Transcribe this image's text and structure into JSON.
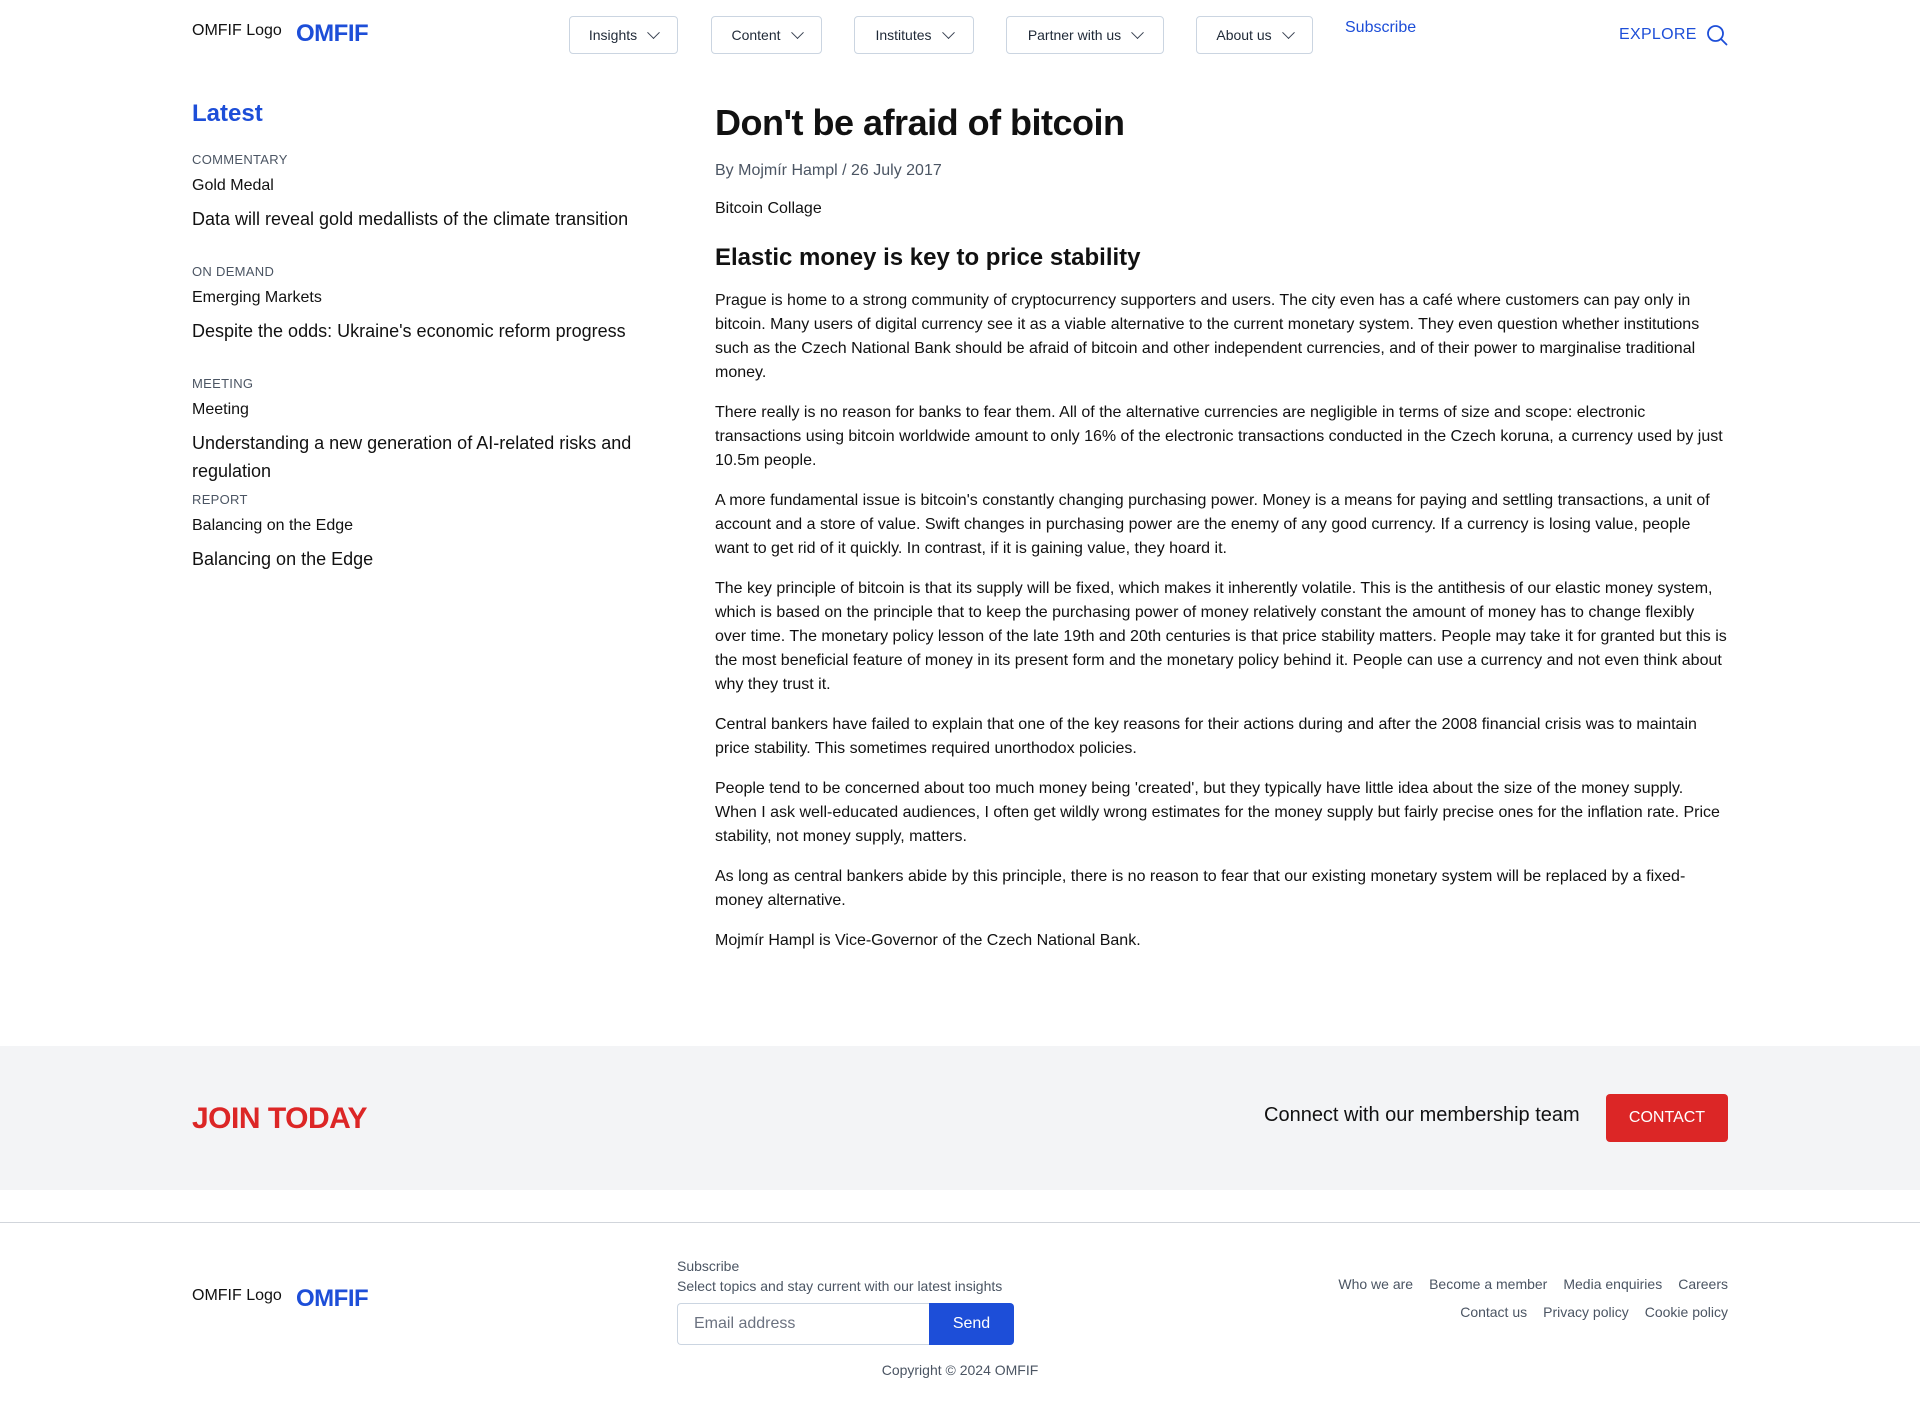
{
  "header": {
    "logo_alt": "OMFIF Logo",
    "logo_text": "OMFIF",
    "nav": [
      {
        "label": "Insights"
      },
      {
        "label": "Content"
      },
      {
        "label": "Institutes"
      },
      {
        "label": "Partner with us"
      },
      {
        "label": "About us"
      }
    ],
    "subscribe": "Subscribe",
    "explore": "EXPLORE",
    "search_icon": "search-icon"
  },
  "sidebar": {
    "title": "Latest",
    "items": [
      {
        "category": "COMMENTARY",
        "subtitle": "Gold Medal",
        "headline": "Data will reveal gold medallists of the climate transition"
      },
      {
        "category": "ON DEMAND",
        "subtitle": "Emerging Markets",
        "headline": "Despite the odds: Ukraine's economic reform progress"
      },
      {
        "category": "MEETING",
        "subtitle": "Meeting",
        "headline": "Understanding a new generation of AI-related risks and regulation"
      },
      {
        "category": "REPORT",
        "subtitle": "Balancing on the Edge",
        "headline": "Balancing on the Edge"
      }
    ]
  },
  "article": {
    "title": "Don't be afraid of bitcoin",
    "byline": "By Mojmír Hampl / 26 July 2017",
    "image_alt": "Bitcoin Collage",
    "subheading": "Elastic money is key to price stability",
    "paragraphs": [
      "Prague is home to a strong community of cryptocurrency supporters and users. The city even has a café where customers can pay only in bitcoin. Many users of digital currency see it as a viable alternative to the current monetary system. They even question whether institutions such as the Czech National Bank should be afraid of bitcoin and other independent currencies, and of their power to marginalise traditional money.",
      "There really is no reason for banks to fear them. All of the alternative currencies are negligible in terms of size and scope: electronic transactions using bitcoin worldwide amount to only 16% of the electronic transactions conducted in the Czech koruna, a currency used by just 10.5m people.",
      "A more fundamental issue is bitcoin's constantly changing purchasing power. Money is a means for paying and settling transactions, a unit of account and a store of value. Swift changes in purchasing power are the enemy of any good currency. If a currency is losing value, people want to get rid of it quickly. In contrast, if it is gaining value, they hoard it.",
      "The key principle of bitcoin is that its supply will be fixed, which makes it inherently volatile. This is the antithesis of our elastic money system, which is based on the principle that to keep the purchasing power of money relatively constant the amount of money has to change flexibly over time. The monetary policy lesson of the late 19th and 20th centuries is that price stability matters. People may take it for granted but this is the most beneficial feature of money in its present form and the monetary policy behind it. People can use a currency and not even think about why they trust it.",
      "Central bankers have failed to explain that one of the key reasons for their actions during and after the 2008 financial crisis was to maintain price stability. This sometimes required unorthodox policies.",
      "People tend to be concerned about too much money being 'created', but they typically have little idea about the size of the money supply. When I ask well-educated audiences, I often get wildly wrong estimates for the money supply but fairly precise ones for the inflation rate. Price stability, not money supply, matters.",
      "As long as central bankers abide by this principle, there is no reason to fear that our existing monetary system will be replaced by a fixed-money alternative.",
      "Mojmír Hampl is Vice-Governor of the Czech National Bank."
    ]
  },
  "join": {
    "title": "JOIN TODAY",
    "connect_text": "Connect with our membership team",
    "contact_button": "CONTACT"
  },
  "footer": {
    "logo_alt": "OMFIF Logo",
    "logo_text": "OMFIF",
    "subscribe_label": "Subscribe",
    "subscribe_desc": "Select topics and stay current with our latest insights",
    "email_placeholder": "Email address",
    "send_button": "Send",
    "links_row1": [
      "Who we are",
      "Become a member",
      "Media enquiries",
      "Careers"
    ],
    "links_row2": [
      "Contact us",
      "Privacy policy",
      "Cookie policy"
    ],
    "copyright": "Copyright © 2024 OMFIF"
  },
  "colors": {
    "brand_blue": "#1d4ed8",
    "brand_red": "#dc2626",
    "band_gray": "#f3f4f6"
  }
}
